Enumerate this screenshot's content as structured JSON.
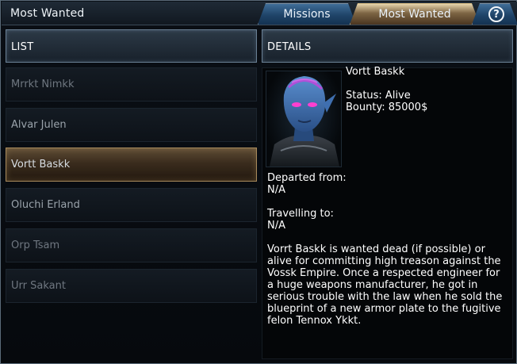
{
  "window": {
    "title": "Most Wanted"
  },
  "tabs": [
    {
      "label": "Missions",
      "active": false
    },
    {
      "label": "Most Wanted",
      "active": true
    }
  ],
  "help": {
    "glyph": "?"
  },
  "list": {
    "header": "LIST",
    "items": [
      {
        "label": "Mrrkt Nimkk"
      },
      {
        "label": "Alvar Julen"
      },
      {
        "label": "Vortt Baskk",
        "selected": true
      },
      {
        "label": "Oluchi Erland"
      },
      {
        "label": "Orp Tsam"
      },
      {
        "label": "Urr Sakant"
      }
    ]
  },
  "details": {
    "header": "DETAILS",
    "name": "Vortt Baskk",
    "status": "Status: Alive",
    "bounty": "Bounty: 85000$",
    "departed_label": "Departed from:",
    "departed_value": "N/A",
    "travelling_label": "Travelling to:",
    "travelling_value": "N/A",
    "description": "Vorrt Baskk is wanted dead (if possible) or alive for committing high treason against the Vossk Empire. Once a respected engineer for a huge weapons manufacturer, he got in serious trouble with the law when he sold the blueprint of a new armor plate to the fugitive felon Tennox Ykkt."
  },
  "colors": {
    "tab_active": "#7c6443",
    "tab_inactive": "#1f4468",
    "selected_item": "#5e4c35"
  }
}
